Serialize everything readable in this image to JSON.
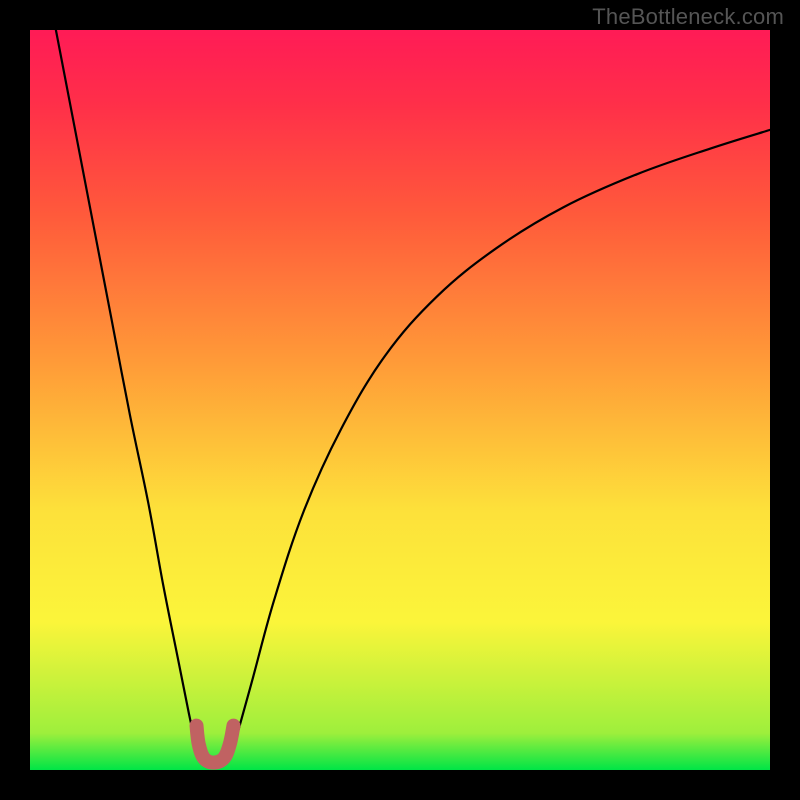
{
  "watermark": "TheBottleneck.com",
  "chart_data": {
    "type": "line",
    "title": "",
    "xlabel": "",
    "ylabel": "",
    "xlim": [
      0,
      1
    ],
    "ylim": [
      0,
      1
    ],
    "background_gradient": {
      "stops": [
        {
          "t": 0.0,
          "color": "#00e546"
        },
        {
          "t": 0.05,
          "color": "#9eef3c"
        },
        {
          "t": 0.2,
          "color": "#fbf53a"
        },
        {
          "t": 0.35,
          "color": "#fde13a"
        },
        {
          "t": 0.55,
          "color": "#ff9b38"
        },
        {
          "t": 0.75,
          "color": "#ff5a3b"
        },
        {
          "t": 0.9,
          "color": "#ff2f49"
        },
        {
          "t": 1.0,
          "color": "#ff1b56"
        }
      ]
    },
    "series": [
      {
        "name": "left-descent",
        "x": [
          0.035,
          0.06,
          0.085,
          0.11,
          0.135,
          0.16,
          0.18,
          0.2,
          0.215,
          0.225
        ],
        "y": [
          1.0,
          0.87,
          0.74,
          0.61,
          0.48,
          0.36,
          0.25,
          0.15,
          0.075,
          0.03
        ],
        "stroke": "#000000",
        "width": 2.2
      },
      {
        "name": "right-ascent",
        "x": [
          0.275,
          0.3,
          0.33,
          0.37,
          0.42,
          0.48,
          0.55,
          0.63,
          0.72,
          0.82,
          0.92,
          1.0
        ],
        "y": [
          0.03,
          0.12,
          0.23,
          0.35,
          0.46,
          0.56,
          0.64,
          0.705,
          0.76,
          0.805,
          0.84,
          0.865
        ],
        "stroke": "#000000",
        "width": 2.2
      },
      {
        "name": "valley-highlight",
        "x": [
          0.225,
          0.228,
          0.235,
          0.248,
          0.262,
          0.27,
          0.275
        ],
        "y": [
          0.06,
          0.035,
          0.016,
          0.01,
          0.016,
          0.035,
          0.06
        ],
        "stroke": "#c06262",
        "width": 14
      }
    ],
    "annotations": []
  }
}
